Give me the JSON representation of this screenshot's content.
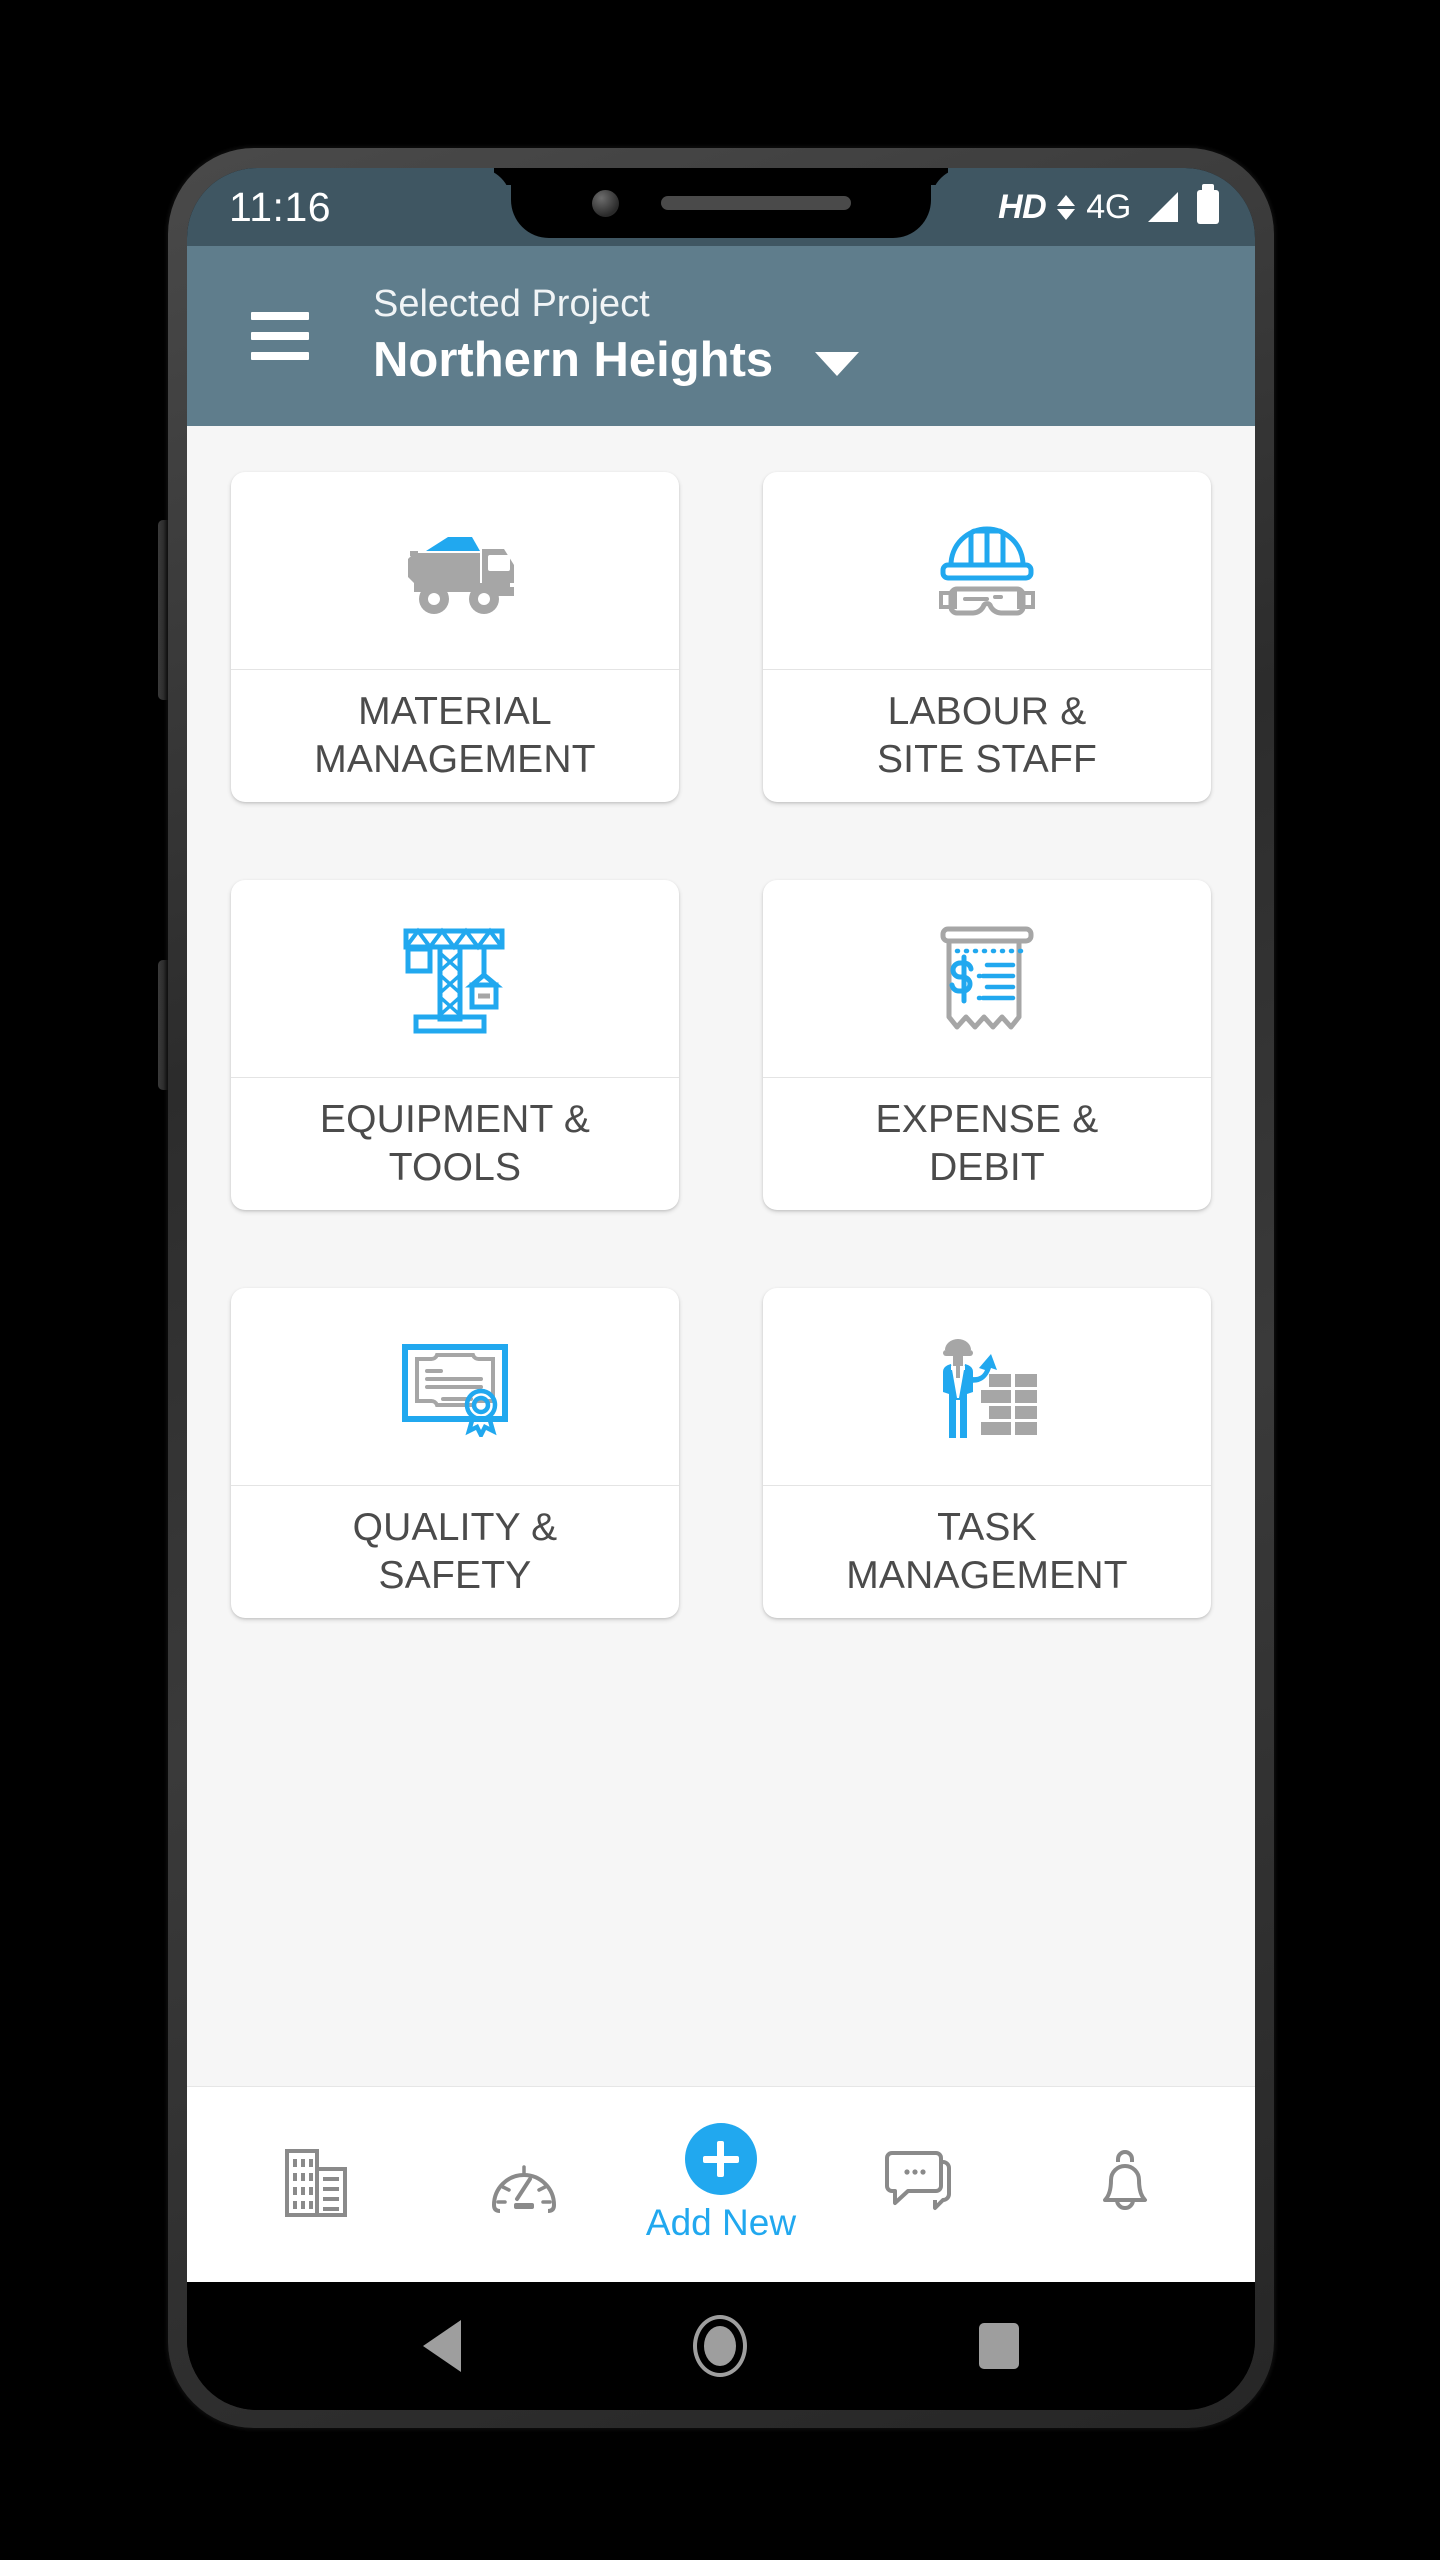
{
  "status_bar": {
    "time": "11:16",
    "hd_label": "HD",
    "network_label": "4G",
    "icons": [
      "hd-icon",
      "data-arrows-icon",
      "signal-icon",
      "battery-icon"
    ]
  },
  "app_bar": {
    "menu_icon": "hamburger-menu-icon",
    "subtitle": "Selected Project",
    "title": "Northern Heights",
    "dropdown_icon": "chevron-down-icon",
    "background_color": "#5f7d8c"
  },
  "theme": {
    "accent_color": "#21a8ef",
    "icon_gray": "#a6a6a6",
    "label_color": "#4b4b4b",
    "content_background": "#f6f6f6",
    "status_bar_color": "#3f5662"
  },
  "modules": [
    {
      "id": "material-management",
      "label": "MATERIAL\nMANAGEMENT",
      "icon": "dump-truck-icon"
    },
    {
      "id": "labour-site-staff",
      "label": "LABOUR &\nSITE STAFF",
      "icon": "hard-hat-goggles-icon"
    },
    {
      "id": "equipment-tools",
      "label": "EQUIPMENT &\nTOOLS",
      "icon": "tower-crane-icon"
    },
    {
      "id": "expense-debit",
      "label": "EXPENSE &\nDEBIT",
      "icon": "receipt-icon"
    },
    {
      "id": "quality-safety",
      "label": "QUALITY &\nSAFETY",
      "icon": "certificate-icon"
    },
    {
      "id": "task-management",
      "label": "TASK\nMANAGEMENT",
      "icon": "worker-bricks-icon"
    }
  ],
  "bottom_nav": {
    "items": [
      {
        "id": "projects",
        "icon": "buildings-icon"
      },
      {
        "id": "dashboard",
        "icon": "speedometer-icon"
      },
      {
        "id": "messages",
        "icon": "chat-bubbles-icon"
      },
      {
        "id": "notifications",
        "icon": "bell-icon"
      }
    ],
    "fab": {
      "label": "Add New",
      "icon": "plus-icon"
    }
  },
  "android_nav": {
    "back": "back-triangle-icon",
    "home": "home-circle-icon",
    "recents": "recents-square-icon"
  }
}
